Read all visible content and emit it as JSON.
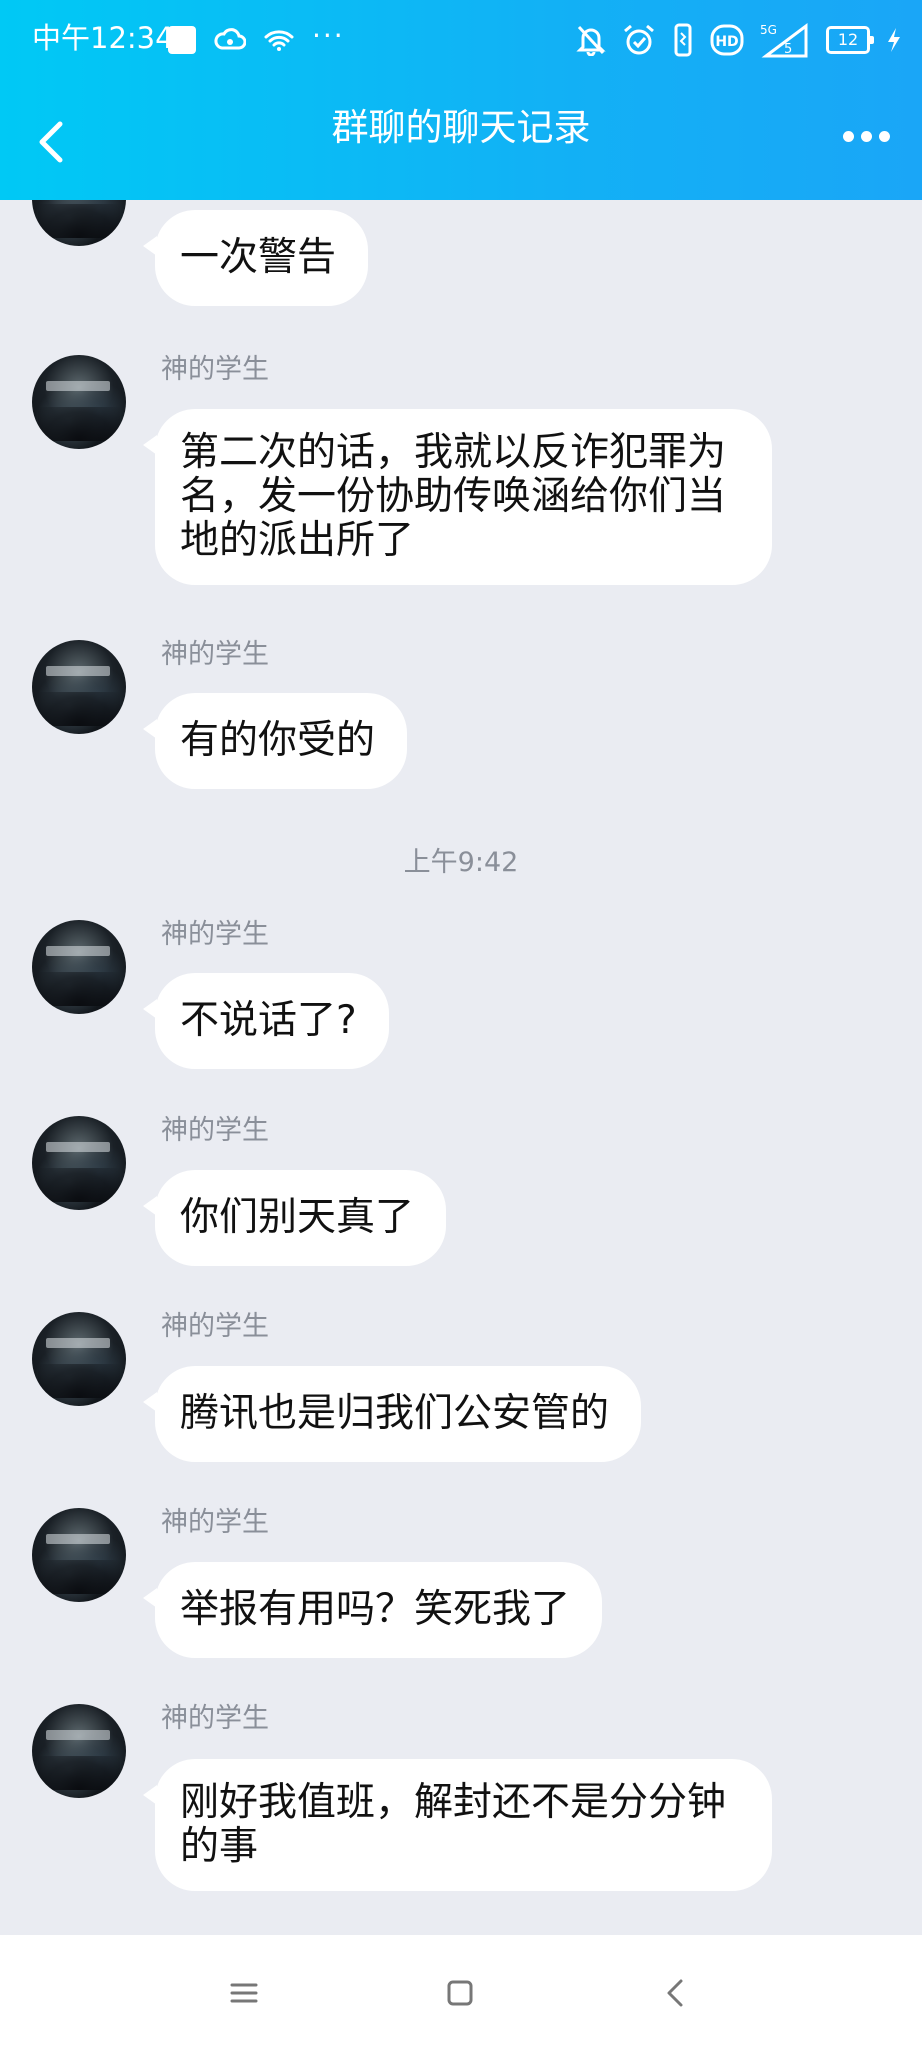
{
  "status_bar": {
    "time": "中午12:34",
    "left_icons": [
      "square-icon",
      "cloud-icon",
      "wifi-icon",
      "more-dots"
    ],
    "dots": "···",
    "right_icons": [
      "bell-off-icon",
      "alarm-icon",
      "vibrate-icon",
      "hd-icon",
      "signal-5g-icon",
      "battery-icon",
      "charging-icon"
    ],
    "battery_level": "12"
  },
  "header": {
    "title": "群聊的聊天记录",
    "background_from": "#00c9f5",
    "background_to": "#1aa6f7"
  },
  "messages": [
    {
      "sender": "",
      "lines": [
        "一次警告"
      ]
    },
    {
      "sender": "神的学生",
      "lines": [
        "第二次的话，我就以反诈犯罪为",
        "名，发一份协助传唤涵给你们当",
        "地的派出所了"
      ]
    },
    {
      "sender": "神的学生",
      "lines": [
        "有的你受的"
      ]
    },
    {
      "timestamp": "上午9:42"
    },
    {
      "sender": "神的学生",
      "lines": [
        "不说话了?"
      ]
    },
    {
      "sender": "神的学生",
      "lines": [
        "你们别天真了"
      ]
    },
    {
      "sender": "神的学生",
      "lines": [
        "腾讯也是归我们公安管的"
      ]
    },
    {
      "sender": "神的学生",
      "lines": [
        "举报有用吗？笑死我了"
      ]
    },
    {
      "sender": "神的学生",
      "lines": [
        "刚好我值班，解封还不是分分钟",
        "的事"
      ]
    }
  ],
  "system_nav": [
    "menu-icon",
    "home-icon",
    "back-icon"
  ]
}
